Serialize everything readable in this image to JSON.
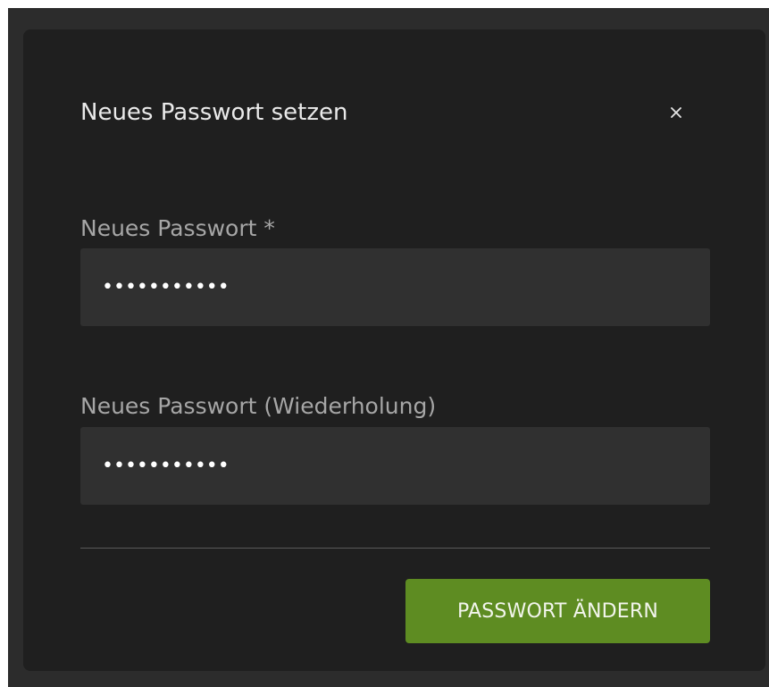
{
  "dialog": {
    "title": "Neues Passwort setzen",
    "close_icon": "close-icon"
  },
  "form": {
    "password": {
      "label": "Neues Passwort *",
      "value": "•••••••••••"
    },
    "password_repeat": {
      "label": "Neues Passwort (Wiederholung)",
      "value": "•••••••••••"
    },
    "submit_label": "PASSWORT ÄNDERN"
  },
  "colors": {
    "modal_background": "#1f1f1f",
    "backdrop": "#2c2c2c",
    "input_background": "#303030",
    "accent_button": "#5e8c22"
  }
}
